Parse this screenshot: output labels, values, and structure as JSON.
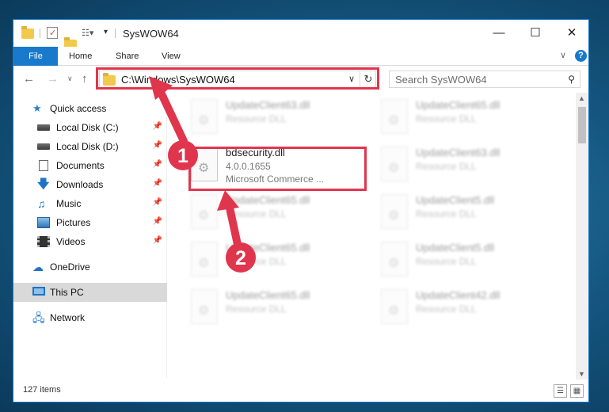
{
  "window": {
    "title": "SysWOW64",
    "controls": {
      "minimize": "—",
      "maximize": "☐",
      "close": "✕"
    }
  },
  "ribbon": {
    "tabs": [
      "File",
      "Home",
      "Share",
      "View"
    ],
    "expand": "∨",
    "help": "?"
  },
  "address": {
    "path": "C:\\Windows\\SysWOW64",
    "dropdown": "∨",
    "refresh": "↻"
  },
  "search": {
    "placeholder": "Search SysWOW64",
    "icon": "search-icon"
  },
  "navpane": {
    "items": [
      {
        "label": "Quick access",
        "icon": "star-icon",
        "pinned": false
      },
      {
        "label": "Local Disk (C:)",
        "icon": "drive-icon",
        "pinned": true
      },
      {
        "label": "Local Disk (D:)",
        "icon": "drive-icon",
        "pinned": true
      },
      {
        "label": "Documents",
        "icon": "documents-icon",
        "pinned": true
      },
      {
        "label": "Downloads",
        "icon": "downloads-icon",
        "pinned": true
      },
      {
        "label": "Music",
        "icon": "music-icon",
        "pinned": true
      },
      {
        "label": "Pictures",
        "icon": "pictures-icon",
        "pinned": true
      },
      {
        "label": "Videos",
        "icon": "videos-icon",
        "pinned": true
      },
      {
        "label": "OneDrive",
        "icon": "cloud-icon",
        "pinned": false
      },
      {
        "label": "This PC",
        "icon": "computer-icon",
        "pinned": false,
        "selected": true
      },
      {
        "label": "Network",
        "icon": "network-icon",
        "pinned": false
      }
    ]
  },
  "files": {
    "col1": [
      {
        "name": "UpdateClient63.dll",
        "desc": "Resource DLL"
      },
      {
        "name": "bdsecurity.dll",
        "desc": "4.0.0.1655",
        "desc2": "Microsoft Commerce ..."
      },
      {
        "name": "UpdateClient65.dll",
        "desc": "Resource DLL"
      },
      {
        "name": "UpdateClient65.dll",
        "desc": "Resource DLL"
      },
      {
        "name": "UpdateClient65.dll",
        "desc": "Resource DLL"
      }
    ],
    "col2": [
      {
        "name": "UpdateClient65.dll",
        "desc": "Resource DLL"
      },
      {
        "name": "UpdateClient63.dll",
        "desc": "Resource DLL"
      },
      {
        "name": "UpdateClient5.dll",
        "desc": "Resource DLL"
      },
      {
        "name": "UpdateClient5.dll",
        "desc": "Resource DLL"
      },
      {
        "name": "UpdateClient42.dll",
        "desc": "Resource DLL"
      }
    ]
  },
  "status": {
    "count": "127 items"
  },
  "annotations": {
    "step1": "1",
    "step2": "2",
    "color": "#e0364d"
  }
}
